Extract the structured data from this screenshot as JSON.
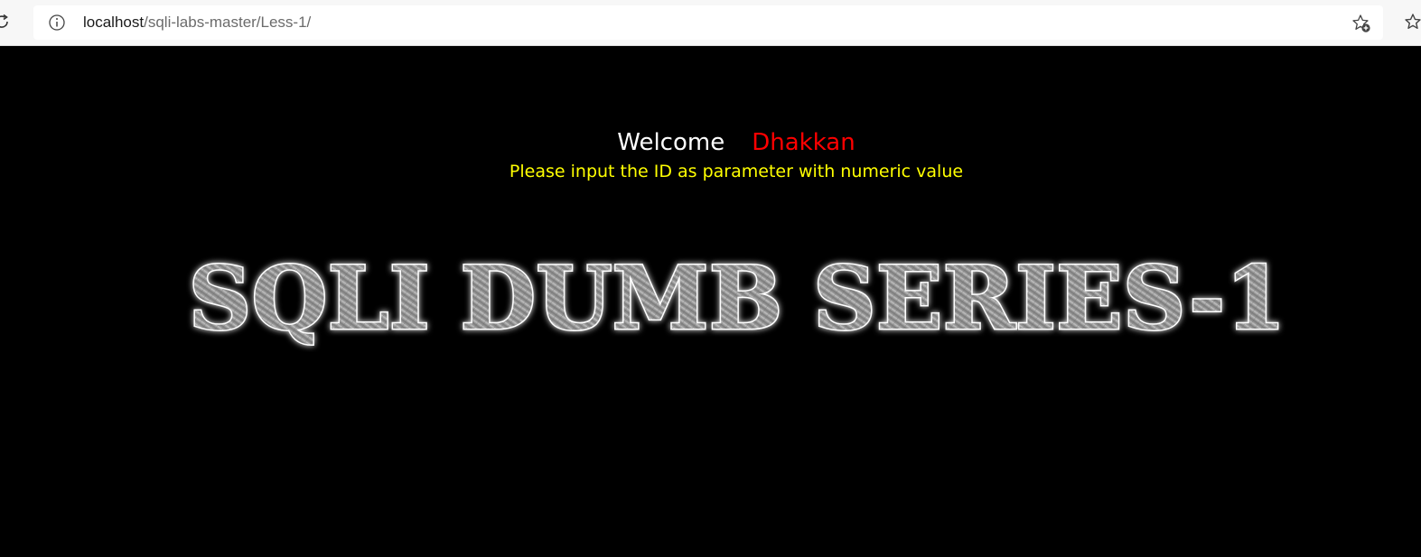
{
  "browser": {
    "url_host": "localhost",
    "url_path": "/sqli-labs-master/Less-1/",
    "icons": {
      "reload": "reload-icon",
      "info": "info-icon",
      "favorite": "add-favorite-icon",
      "favorites_list": "favorites-icon"
    }
  },
  "page": {
    "welcome": "Welcome",
    "name": "Dhakkan",
    "instruction": "Please input the ID as parameter with numeric value",
    "banner_text": "SQLI DUMB SERIES-1",
    "colors": {
      "background": "#000000",
      "welcome": "#ffffff",
      "name": "#ff0000",
      "instruction": "#ffff00",
      "banner_fill": "#8c8c8c"
    }
  }
}
